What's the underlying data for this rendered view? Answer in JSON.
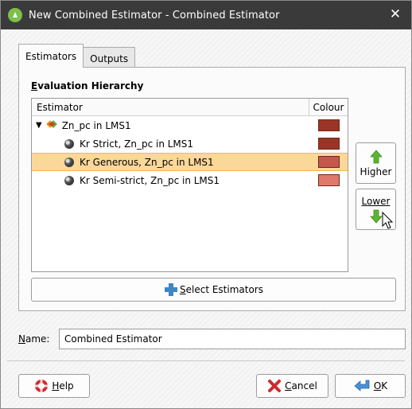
{
  "window": {
    "title": "New Combined Estimator - Combined Estimator",
    "close_glyph": "✕"
  },
  "tabs": [
    {
      "label": "Estimators",
      "active": true
    },
    {
      "label": "Outputs",
      "active": false
    }
  ],
  "section": {
    "label_prefix": "E",
    "label_rest": "valuation Hierarchy"
  },
  "tree": {
    "columns": {
      "estimator": "Estimator",
      "colour": "Colour"
    },
    "rows": [
      {
        "label": "Zn_pc in LMS1",
        "colour": "#9b3426",
        "level": 0,
        "selected": false
      },
      {
        "label": "Kr Strict, Zn_pc in LMS1",
        "colour": "#9a3427",
        "level": 1,
        "selected": false
      },
      {
        "label": "Kr Generous, Zn_pc in LMS1",
        "colour": "#c6574d",
        "level": 1,
        "selected": true
      },
      {
        "label": "Kr Semi-strict, Zn_pc in LMS1",
        "colour": "#e0796b",
        "level": 1,
        "selected": false
      }
    ]
  },
  "side_buttons": {
    "higher_label": "Higher",
    "lower_label": "Lower"
  },
  "select_button": {
    "prefix": "S",
    "rest": "elect Estimators"
  },
  "name_field": {
    "label_prefix": "N",
    "label_rest": "ame:",
    "value": "Combined Estimator"
  },
  "footer": {
    "help_prefix": "H",
    "help_rest": "elp",
    "cancel_prefix": "C",
    "cancel_rest": "ancel",
    "ok_prefix": "O",
    "ok_rest": "K"
  },
  "colors": {
    "selection": "#fcd79a",
    "titlebar": "#3a3a3a",
    "green_arrow": "#5cb532"
  }
}
